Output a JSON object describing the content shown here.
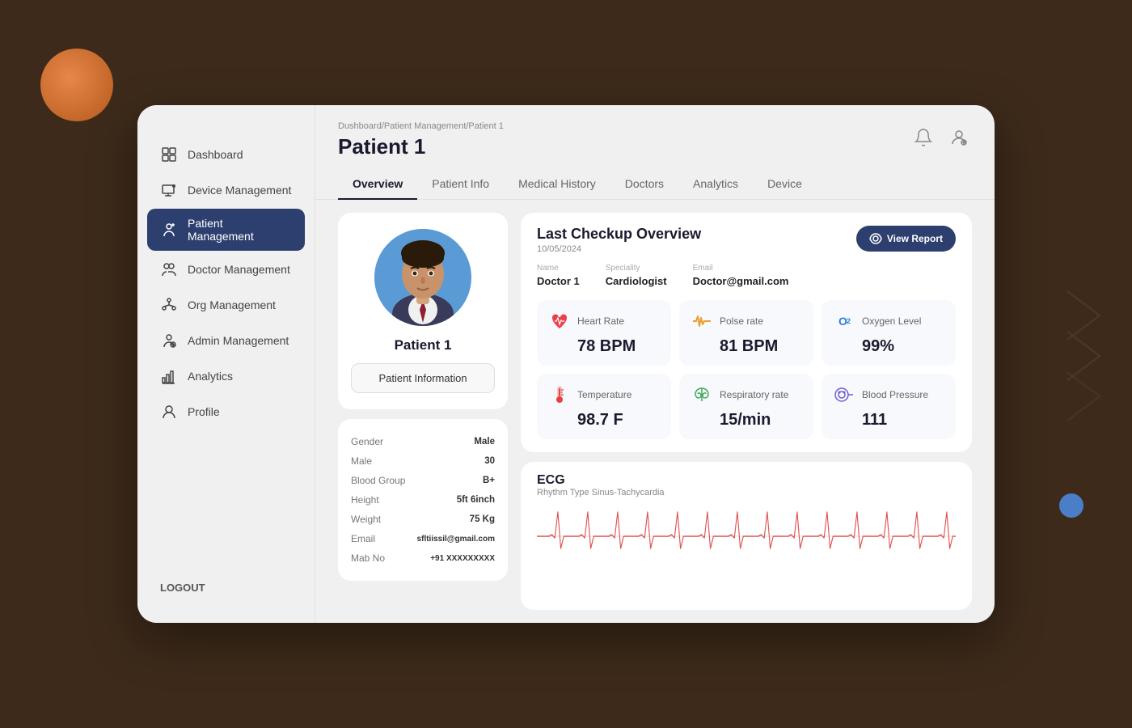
{
  "background": {
    "colors": {
      "primary": "#3d2a1a",
      "sidebar_bg": "#f0f0f0",
      "card_bg": "#ffffff"
    }
  },
  "sidebar": {
    "items": [
      {
        "id": "dashboard",
        "label": "Dashboard",
        "icon": "▦",
        "active": false
      },
      {
        "id": "device-management",
        "label": "Device Management",
        "icon": "⊞",
        "active": false
      },
      {
        "id": "patient-management",
        "label": "Patient Management",
        "icon": "👤",
        "active": true
      },
      {
        "id": "doctor-management",
        "label": "Doctor Management",
        "icon": "👥",
        "active": false
      },
      {
        "id": "org-management",
        "label": "Org Management",
        "icon": "⚙",
        "active": false
      },
      {
        "id": "admin-management",
        "label": "Admin Management",
        "icon": "👤",
        "active": false
      },
      {
        "id": "analytics",
        "label": "Analytics",
        "icon": "📊",
        "active": false
      },
      {
        "id": "profile",
        "label": "Profile",
        "icon": "👤",
        "active": false
      }
    ],
    "logout_label": "LOGOUT"
  },
  "header": {
    "breadcrumb": "Dushboard/Patient Management/Patient 1",
    "title": "Patient 1"
  },
  "tabs": [
    {
      "id": "overview",
      "label": "Overview",
      "active": true
    },
    {
      "id": "patient-info",
      "label": "Patient Info",
      "active": false
    },
    {
      "id": "medical-history",
      "label": "Medical History",
      "active": false
    },
    {
      "id": "doctors",
      "label": "Doctors",
      "active": false
    },
    {
      "id": "analytics",
      "label": "Analytics",
      "active": false
    },
    {
      "id": "device",
      "label": "Device",
      "active": false
    }
  ],
  "patient": {
    "name": "Patient 1",
    "info_btn": "Patient Information",
    "gender": "Male",
    "male_value": "30",
    "blood_group": "B+",
    "height": "5ft 6inch",
    "weight": "75 Kg",
    "email": "sfltiissil@gmail.com",
    "mob_no": "+91 XXXXXXXXX",
    "gender_label": "Gender",
    "male_label": "Male",
    "blood_group_label": "Blood Group",
    "height_label": "Height",
    "weight_label": "Weight",
    "email_label": "Email",
    "mob_label": "Mab No"
  },
  "checkup": {
    "title": "Last Checkup Overview",
    "date": "10/05/2024",
    "doctor": {
      "name_label": "Name",
      "name_value": "Doctor 1",
      "speciality_label": "Speciality",
      "speciality_value": "Cardiologist",
      "email_label": "Email",
      "email_value": "Doctor@gmail.com"
    },
    "view_report_btn": "View Report",
    "vitals": [
      {
        "id": "heart-rate",
        "label": "Heart Rate",
        "value": "78 BPM",
        "icon_char": "❤",
        "color": "#e8424a"
      },
      {
        "id": "pulse-rate",
        "label": "Polse rate",
        "value": "81 BPM",
        "icon_char": "〜",
        "color": "#e8a030"
      },
      {
        "id": "oxygen-level",
        "label": "Oxygen Level",
        "value": "99%",
        "icon_char": "O₂",
        "color": "#2a7fd4"
      },
      {
        "id": "temperature",
        "label": "Temperature",
        "value": "98.7 F",
        "icon_char": "🌡",
        "color": "#e84040"
      },
      {
        "id": "respiratory-rate",
        "label": "Respiratory rate",
        "value": "15/min",
        "icon_char": "🫁",
        "color": "#3caa5c"
      },
      {
        "id": "blood-pressure",
        "label": "Blood Pressure",
        "value": "111",
        "icon_char": "⊕",
        "color": "#6b5fd4"
      }
    ]
  },
  "ecg": {
    "title": "ECG",
    "subtitle": "Rhythm Type Sinus-Tachycardia"
  }
}
